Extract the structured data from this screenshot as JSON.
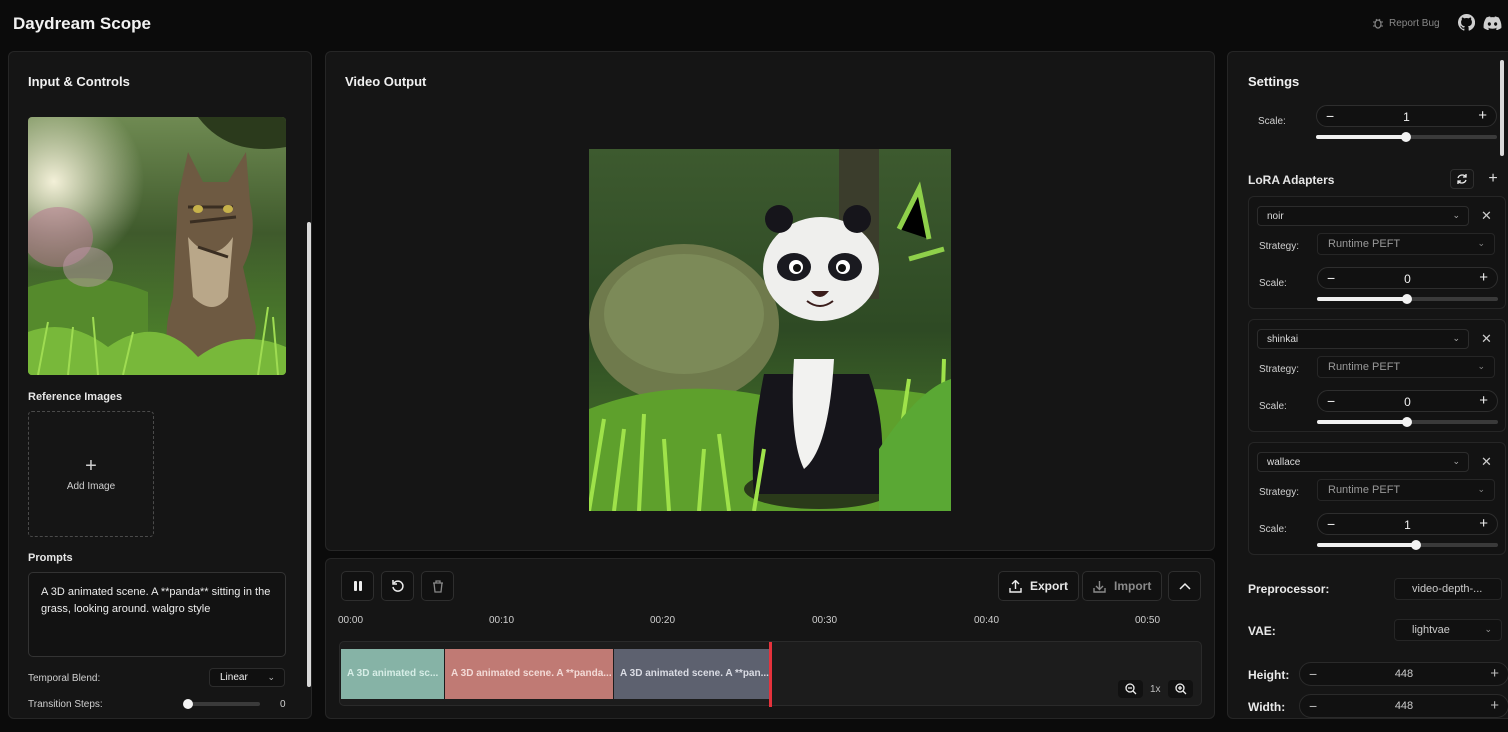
{
  "header": {
    "app_title": "Daydream Scope",
    "report_bug_label": "Report Bug",
    "github_icon": "github-icon",
    "discord_icon": "discord-icon"
  },
  "left_panel": {
    "title": "Input & Controls",
    "reference_images_label": "Reference Images",
    "add_image_label": "Add Image",
    "prompts_label": "Prompts",
    "prompt_text": "A 3D animated scene. A **panda** sitting in the grass, looking around. walgro style",
    "temporal_blend_label": "Temporal Blend:",
    "temporal_blend_value": "Linear",
    "transition_steps_label": "Transition Steps:",
    "transition_steps_value": "0"
  },
  "center_panel": {
    "title": "Video Output"
  },
  "timeline": {
    "export_label": "Export",
    "import_label": "Import",
    "ticks": [
      "00:00",
      "00:10",
      "00:20",
      "00:30",
      "00:40",
      "00:50"
    ],
    "clips": [
      {
        "label": "A 3D animated sc...",
        "color": "#86b3a6",
        "text_color": "#d6ede6"
      },
      {
        "label": "A 3D animated scene. A **panda...",
        "color": "#c07a74",
        "text_color": "#f3dad6"
      },
      {
        "label": "A 3D animated scene. A **pan...",
        "color": "#5d616f",
        "text_color": "#dadce4"
      }
    ],
    "zoom_value": "1x",
    "playhead_color": "#e5323c"
  },
  "settings": {
    "title": "Settings",
    "top_scale_label": "Scale:",
    "top_scale_value": "1",
    "lora_title": "LoRA Adapters",
    "strategy_label": "Strategy:",
    "scale_label": "Scale:",
    "loras": [
      {
        "name": "noir",
        "strategy": "Runtime PEFT",
        "scale": "0"
      },
      {
        "name": "shinkai",
        "strategy": "Runtime PEFT",
        "scale": "0"
      },
      {
        "name": "wallace",
        "strategy": "Runtime PEFT",
        "scale": "1"
      }
    ],
    "preprocessor_label": "Preprocessor:",
    "preprocessor_value": "video-depth-...",
    "vae_label": "VAE:",
    "vae_value": "lightvae",
    "height_label": "Height:",
    "height_value": "448",
    "width_label": "Width:",
    "width_value": "448"
  },
  "colors": {
    "background": "#0b0b0b",
    "panel": "#151515",
    "accent_red": "#e5323c"
  }
}
